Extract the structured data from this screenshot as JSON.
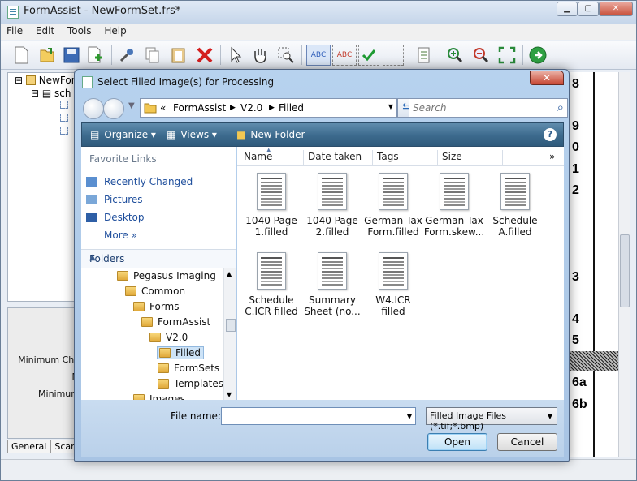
{
  "main_window": {
    "title": "FormAssist - NewFormSet.frs*",
    "menu": [
      "File",
      "Edit",
      "Tools",
      "Help"
    ],
    "tree_root": "NewFor",
    "tree_child": "sch",
    "props_labels": [
      "Minimum Cha",
      "M",
      "Minimum",
      "R"
    ],
    "bottom_tabs": [
      "General",
      "Scan"
    ],
    "doc_numbers": [
      "8",
      "9",
      "0",
      "1",
      "2",
      "3",
      "4",
      "5",
      "6a",
      "6b"
    ],
    "colors": {
      "accent": "#3c6a8d",
      "title_bg": "#c6d6ea"
    }
  },
  "dialog": {
    "title": "Select Filled Image(s) for Processing",
    "close_label": "✕",
    "address": [
      "«",
      "FormAssist",
      "V2.0",
      "Filled"
    ],
    "search_placeholder": "Search",
    "commands": {
      "organize": "Organize",
      "views": "Views",
      "new_folder": "New Folder"
    },
    "favorites_header": "Favorite Links",
    "favorites": [
      "Recently Changed",
      "Pictures",
      "Desktop"
    ],
    "more_label": "More",
    "more_chevron": "»",
    "folders_label": "Folders",
    "tree": [
      {
        "label": "Pegasus Imaging",
        "level": 0
      },
      {
        "label": "Common",
        "level": 1
      },
      {
        "label": "Forms",
        "level": 2
      },
      {
        "label": "FormAssist",
        "level": 3
      },
      {
        "label": "V2.0",
        "level": 4
      },
      {
        "label": "Filled",
        "level": 5,
        "selected": true
      },
      {
        "label": "FormSets",
        "level": 5
      },
      {
        "label": "Templates",
        "level": 5
      },
      {
        "label": "Images",
        "level": 2
      }
    ],
    "columns": [
      "Name",
      "Date taken",
      "Tags",
      "Size"
    ],
    "columns_more": "»",
    "files": [
      {
        "line1": "1040 Page",
        "line2": "1.filled"
      },
      {
        "line1": "1040 Page",
        "line2": "2.filled"
      },
      {
        "line1": "German Tax",
        "line2": "Form.filled"
      },
      {
        "line1": "German Tax",
        "line2": "Form.skew..."
      },
      {
        "line1": "Schedule",
        "line2": "A.filled"
      },
      {
        "line1": "Schedule",
        "line2": "C.ICR filled"
      },
      {
        "line1": "Summary",
        "line2": "Sheet (no..."
      },
      {
        "line1": "W4.ICR filled",
        "line2": ""
      }
    ],
    "file_name_label": "File name:",
    "file_name_value": "",
    "filter_value": "Filled Image Files (*.tif;*.bmp)",
    "open_label": "Open",
    "cancel_label": "Cancel"
  }
}
